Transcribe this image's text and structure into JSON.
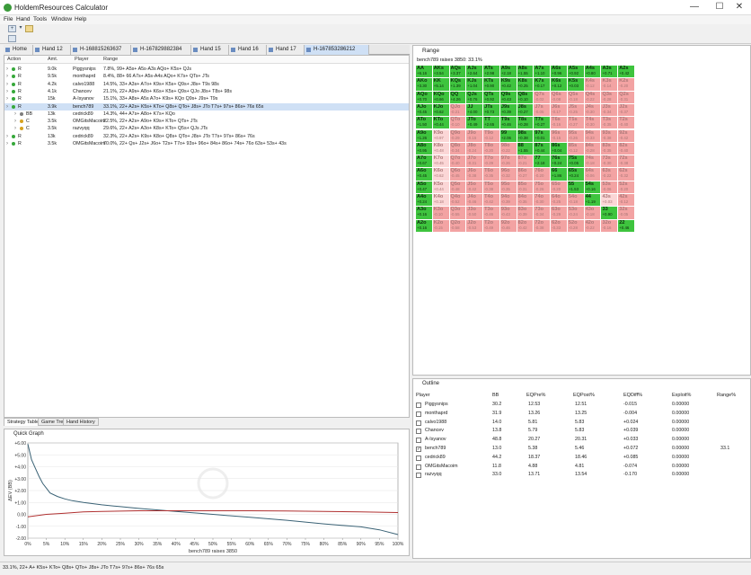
{
  "window": {
    "title": "HoldemResources Calculator",
    "minimize": "—",
    "maximize": "☐",
    "close": "✕"
  },
  "menu": [
    "File",
    "Hand",
    "Tools",
    "Window",
    "Help"
  ],
  "tabs": [
    "Home",
    "Hand 12",
    "H-168815263637",
    "H-167829882384",
    "Hand 15",
    "Hand 16",
    "Hand 17",
    "H-167853286212"
  ],
  "active_tab": 7,
  "strategy": {
    "headers": [
      "Action",
      "Amt.",
      "Player",
      "Range"
    ],
    "rows": [
      {
        "indent": 0,
        "action": "R",
        "amt": "9.0k",
        "player": "Piggysnips",
        "range": "7.8%, 99+ A5s+ A5s-A3s AQo+ K5s+ QJs"
      },
      {
        "indent": 0,
        "action": "R",
        "amt": "9.5k",
        "player": "monthaprd",
        "range": "8.4%, 88+ 66 A7s+ A5s-A4s AQo+ K7s+ QTs+ JTs"
      },
      {
        "indent": 0,
        "action": "R",
        "amt": "4.2k",
        "player": "calvo1988",
        "range": "14.5%, 33+ A3s+ A7o+ K9s+ K5s+ Q9s+ J8s+ T9s 98s"
      },
      {
        "indent": 0,
        "action": "R",
        "amt": "4.1k",
        "player": "Chancev",
        "range": "21.1%, 22+ A9s+ A8o+ K6s+ K5s+ Q9s+ QJo J8s+ T8s+ 98s"
      },
      {
        "indent": 0,
        "action": "R",
        "amt": "15k",
        "player": "A-Isyanov",
        "range": "15.1%, 33+ A8s+ A5s A7o+ K9s+ KQo Q9s+ J9s+ T9s"
      },
      {
        "indent": 0,
        "action": "R",
        "amt": "3.9k",
        "player": "bench789",
        "range": "33.1%, 22+ A2s+ K5s+ KTo+ Q8s+ QTo+ J8s+ JTo T7s+ 97s+ 86s+ 76s 65s",
        "selected": true
      },
      {
        "indent": 1,
        "action": "BB",
        "amt": "13k",
        "player": "cedrick89",
        "range": "14.3%, 44+ A7s+ A8o+ K7s+ KQo"
      },
      {
        "indent": 1,
        "action": "C",
        "amt": "3.5k",
        "player": "OMGitsMacoim",
        "range": "22.5%, 22+ A2s+ A9o+ K9s+ KTo+ QTs+ JTs"
      },
      {
        "indent": 1,
        "action": "C",
        "amt": "3.5k",
        "player": "razvyqq",
        "range": "29.6%, 22+ A2s+ A3o+ K8s+ KTo+ Q5s+ QJs JTs"
      },
      {
        "indent": 0,
        "action": "R",
        "amt": "13k",
        "player": "cedrick89",
        "range": "32.3%, 22+ A2s+ K9s+ K8o+ Q8s+ QTo+ J8s+ JTo T7s+ 97s+ 86s+ 76s"
      },
      {
        "indent": 0,
        "action": "R",
        "amt": "3.5k",
        "player": "OMGitsMacoim",
        "range": "70.0%, 22+ Qs+ J2s+ J6o+ T2s+ T7o+ 93s+ 96o+ 84s+ 86o+ 74s+ 76o 63s+ 53s+ 43s"
      }
    ]
  },
  "bottom_tabs": [
    "Strategy Table",
    "Game Tree",
    "Hand History"
  ],
  "graph": {
    "title": "Quick Graph",
    "xlabel": "bench789 raises 3850",
    "ylabel": "ΔEV (BB)",
    "chart_data": {
      "type": "line",
      "title": "",
      "xlabel": "bench789 raises 3850",
      "ylabel": "ΔEV (BB)",
      "xlim": [
        0,
        100
      ],
      "ylim": [
        -2,
        6
      ],
      "x_ticks": [
        "0%",
        "5%",
        "10%",
        "15%",
        "20%",
        "25%",
        "30%",
        "35%",
        "40%",
        "45%",
        "50%",
        "55%",
        "60%",
        "65%",
        "70%",
        "75%",
        "80%",
        "85%",
        "90%",
        "95%",
        "100%"
      ],
      "y_ticks": [
        "+6.00",
        "+5.00",
        "+4.00",
        "+3.00",
        "+2.00",
        "+1.00",
        "0.00",
        "-1.00",
        "-2.00"
      ],
      "series": [
        {
          "color": "#3a6275",
          "x": [
            0,
            1,
            2,
            3,
            4,
            5,
            6,
            8,
            10,
            12,
            15,
            20,
            25,
            30,
            40,
            50,
            60,
            70,
            80,
            90,
            95,
            100
          ],
          "y": [
            5.9,
            4.6,
            3.9,
            3.2,
            2.6,
            2.2,
            1.8,
            1.5,
            1.3,
            1.15,
            1.0,
            0.8,
            0.65,
            0.5,
            0.25,
            0.0,
            -0.25,
            -0.5,
            -0.8,
            -1.05,
            -1.3,
            -1.7
          ]
        },
        {
          "color": "#b03030",
          "x": [
            0,
            5,
            10,
            15,
            20,
            30,
            40,
            50,
            60,
            70,
            80,
            90,
            100
          ],
          "y": [
            -0.2,
            0.0,
            0.1,
            0.2,
            0.25,
            0.3,
            0.3,
            0.3,
            0.3,
            0.28,
            0.25,
            0.2,
            0.15
          ]
        }
      ]
    }
  },
  "range": {
    "title": "Range",
    "subtitle": "bench789 raises 3850: 33.1%",
    "ranks": [
      "A",
      "K",
      "Q",
      "J",
      "T",
      "9",
      "8",
      "7",
      "6",
      "5",
      "4",
      "3",
      "2"
    ],
    "evs": [
      [
        "+6.16",
        "+3.54",
        "+3.37",
        "+2.64",
        "+2.98",
        "+2.18",
        "+1.55",
        "+1.10",
        "+0.96",
        "+0.92",
        "+0.80",
        "+0.71",
        "+0.42"
      ],
      [
        "+3.30",
        "+5.14",
        "+1.39",
        "+1.04",
        "+0.90",
        "+0.42",
        "+0.25",
        "+0.17",
        "+0.12",
        "+0.03",
        "-0.12",
        "-0.14",
        "-0.20"
      ],
      [
        "+0.70",
        "+0.66",
        "+4.26",
        "+0.76",
        "+0.92",
        "+0.43",
        "+0.10",
        "-0.02",
        "-0.08",
        "-0.18",
        "-0.22",
        "-0.28",
        "-0.31"
      ],
      [
        "+0.45",
        "+0.62",
        "-0.21",
        "+4.00",
        "+0.73",
        "+0.39",
        "+0.27",
        "-0.05",
        "-0.17",
        "-0.25",
        "-0.30",
        "-0.34",
        "-0.37"
      ],
      [
        "+1.50",
        "+0.44",
        "-0.10",
        "+0.49",
        "+2.65",
        "+0.46",
        "+0.28",
        "+0.27",
        "-0.16",
        "-0.27",
        "-0.30",
        "-0.35",
        "-0.40"
      ],
      [
        "+1.26",
        "+0.97",
        "-0.29",
        "-0.15",
        "-0.12",
        "+2.06",
        "+0.38",
        "+0.01",
        "-0.15",
        "-0.26",
        "-0.33",
        "-0.38",
        "-0.42"
      ],
      [
        "+0.95",
        "+0.48",
        "-0.34",
        "-0.24",
        "-0.20",
        "-0.22",
        "+1.55",
        "+0.44",
        "+0.04",
        "-0.12",
        "-0.28",
        "-0.35",
        "-0.40"
      ],
      [
        "+0.67",
        "+0.45",
        "-0.40",
        "-0.31",
        "-0.29",
        "-0.26",
        "-0.21",
        "+2.18",
        "+0.24",
        "+0.05",
        "-0.18",
        "-0.30",
        "-0.38"
      ],
      [
        "+0.45",
        "+0.62",
        "-0.45",
        "-0.38",
        "-0.35",
        "-0.32",
        "-0.27",
        "-0.20",
        "+1.86",
        "+0.24",
        "-0.06",
        "-0.22",
        "-0.32"
      ],
      [
        "+0.47",
        "+0.44",
        "-0.48",
        "-0.42",
        "-0.38",
        "-0.35",
        "-0.31",
        "-0.26",
        "-0.20",
        "+1.53",
        "+0.16",
        "-0.06",
        "-0.20"
      ],
      [
        "+0.24",
        "+0.18",
        "-0.52",
        "-0.46",
        "-0.42",
        "-0.39",
        "-0.35",
        "-0.30",
        "-0.25",
        "-0.18",
        "+1.19",
        "+0.03",
        "-0.12"
      ],
      [
        "+0.16",
        "-0.10",
        "-0.55",
        "-0.50",
        "-0.46",
        "-0.43",
        "-0.39",
        "-0.34",
        "-0.29",
        "-0.24",
        "-0.18",
        "+0.90",
        "-0.05"
      ],
      [
        "+0.16",
        "-0.15",
        "-0.58",
        "-0.53",
        "-0.49",
        "-0.46",
        "-0.42",
        "-0.38",
        "-0.33",
        "-0.28",
        "-0.22",
        "-0.16",
        "+0.46"
      ]
    ],
    "in_range": [
      [
        1,
        1,
        1,
        1,
        1,
        1,
        1,
        1,
        1,
        1,
        1,
        1,
        1
      ],
      [
        1,
        1,
        1,
        1,
        1,
        1,
        1,
        1,
        1,
        1,
        0,
        0,
        0
      ],
      [
        1,
        1,
        1,
        1,
        1,
        1,
        1,
        0,
        0,
        0,
        0,
        0,
        0
      ],
      [
        1,
        1,
        0,
        1,
        1,
        1,
        1,
        0,
        0,
        0,
        0,
        0,
        0
      ],
      [
        1,
        1,
        0,
        1,
        1,
        1,
        1,
        1,
        0,
        0,
        0,
        0,
        0
      ],
      [
        1,
        0,
        0,
        0,
        0,
        1,
        1,
        1,
        0,
        0,
        0,
        0,
        0
      ],
      [
        1,
        0,
        0,
        0,
        0,
        0,
        1,
        1,
        1,
        0,
        0,
        0,
        0
      ],
      [
        1,
        0,
        0,
        0,
        0,
        0,
        0,
        1,
        1,
        1,
        0,
        0,
        0
      ],
      [
        1,
        0,
        0,
        0,
        0,
        0,
        0,
        0,
        1,
        1,
        0,
        0,
        0
      ],
      [
        1,
        0,
        0,
        0,
        0,
        0,
        0,
        0,
        0,
        1,
        1,
        0,
        0
      ],
      [
        1,
        0,
        0,
        0,
        0,
        0,
        0,
        0,
        0,
        0,
        1,
        0,
        0
      ],
      [
        1,
        0,
        0,
        0,
        0,
        0,
        0,
        0,
        0,
        0,
        0,
        1,
        0
      ],
      [
        1,
        0,
        0,
        0,
        0,
        0,
        0,
        0,
        0,
        0,
        0,
        0,
        1
      ]
    ],
    "colors": {
      "in": "#3ec43e",
      "in_light": "#9be39b",
      "out": "#f3a3a3",
      "out_light": "#fbd6d6"
    }
  },
  "outline": {
    "title": "Outline",
    "headers": [
      "Player",
      "BB",
      "EQPre%",
      "EQPost%",
      "EQDiff%",
      "Exploit%",
      "Range%"
    ],
    "rows": [
      {
        "player": "Piggysnips",
        "bb": "30.2",
        "eqpre": "12.53",
        "eqpost": "12.51",
        "eqdiff": "-0.015",
        "exploit": "0.00000",
        "range": "",
        "checked": false
      },
      {
        "player": "monthaprd",
        "bb": "31.9",
        "eqpre": "13.26",
        "eqpost": "13.25",
        "eqdiff": "-0.004",
        "exploit": "0.00000",
        "range": "",
        "checked": false
      },
      {
        "player": "calvo1988",
        "bb": "14.0",
        "eqpre": "5.81",
        "eqpost": "5.83",
        "eqdiff": "+0.024",
        "exploit": "0.00000",
        "range": "",
        "checked": false
      },
      {
        "player": "Chancev",
        "bb": "13.8",
        "eqpre": "5.79",
        "eqpost": "5.83",
        "eqdiff": "+0.039",
        "exploit": "0.00000",
        "range": "",
        "checked": false
      },
      {
        "player": "A-Isyanov",
        "bb": "48.8",
        "eqpre": "20.27",
        "eqpost": "20.31",
        "eqdiff": "+0.033",
        "exploit": "0.00000",
        "range": "",
        "checked": false
      },
      {
        "player": "bench789",
        "bb": "13.0",
        "eqpre": "5.38",
        "eqpost": "5.46",
        "eqdiff": "+0.072",
        "exploit": "0.00000",
        "range": "33.1",
        "checked": true
      },
      {
        "player": "cedrick89",
        "bb": "44.2",
        "eqpre": "18.37",
        "eqpost": "18.46",
        "eqdiff": "+0.085",
        "exploit": "0.00000",
        "range": "",
        "checked": false
      },
      {
        "player": "OMGitsMacoim",
        "bb": "11.8",
        "eqpre": "4.88",
        "eqpost": "4.81",
        "eqdiff": "-0.074",
        "exploit": "0.00000",
        "range": "",
        "checked": false
      },
      {
        "player": "razvyqq",
        "bb": "33.0",
        "eqpre": "13.71",
        "eqpost": "13.54",
        "eqdiff": "-0.170",
        "exploit": "0.00000",
        "range": "",
        "checked": false
      }
    ]
  },
  "status": "33.1%, 22+ A+ K5s+ KTo+ Q8s+ QTo+ J8s+ JTo T7s+ 97s+ 86s+ 76s 65s"
}
